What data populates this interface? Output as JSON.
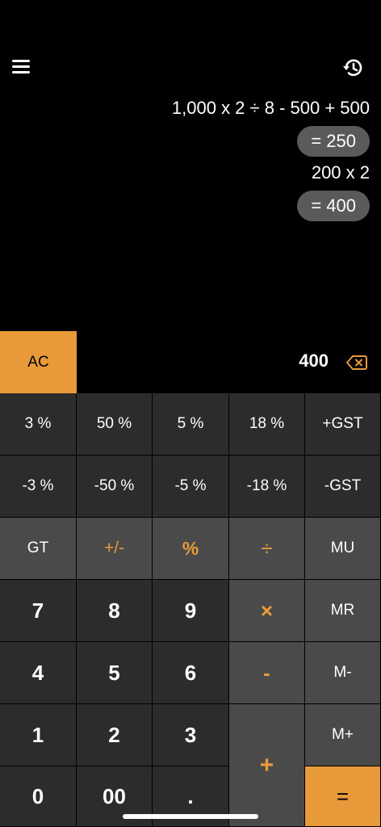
{
  "header": {
    "menu_icon": "hamburger-menu-icon",
    "history_icon": "history-clock-icon"
  },
  "tape": [
    {
      "expression": "1,000 x 2 ÷ 8 - 500 + 500",
      "result": "= 250"
    },
    {
      "expression": "200 x 2",
      "result": "= 400"
    }
  ],
  "display": {
    "ac_label": "AC",
    "value": "400",
    "backspace_icon": "backspace-icon"
  },
  "keypad": {
    "row1": [
      "3 %",
      "50 %",
      "5 %",
      "18 %",
      "+GST"
    ],
    "row2": [
      "-3 %",
      "-50 %",
      "-5 %",
      "-18 %",
      "-GST"
    ],
    "row3": [
      "GT",
      "+/-",
      "%",
      "÷",
      "MU"
    ],
    "row4": [
      "7",
      "8",
      "9",
      "×",
      "MR"
    ],
    "row5": [
      "4",
      "5",
      "6",
      "-",
      "M-"
    ],
    "row6": [
      "1",
      "2",
      "3",
      "+",
      "M+"
    ],
    "row7": [
      "0",
      "00",
      ".",
      "="
    ]
  },
  "colors": {
    "accent": "#e89a3a",
    "key_dark": "#2c2c2c",
    "key_mid": "#4a4a4a",
    "result_pill": "#5a5a5a"
  }
}
